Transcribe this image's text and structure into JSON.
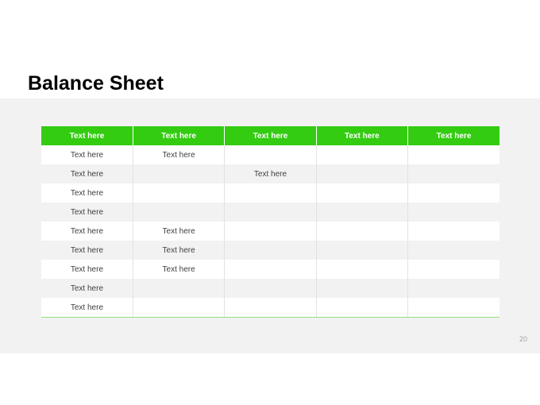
{
  "slide": {
    "title": "Balance Sheet",
    "page_number": "20"
  },
  "colors": {
    "header_bg": "#33cc11",
    "band_bg": "#f2f2f2"
  },
  "table": {
    "headers": [
      "Text here",
      "Text here",
      "Text here",
      "Text here",
      "Text here"
    ],
    "rows": [
      [
        "Text here",
        "Text here",
        "",
        "",
        ""
      ],
      [
        "Text here",
        "",
        "Text here",
        "",
        ""
      ],
      [
        "Text here",
        "",
        "",
        "",
        ""
      ],
      [
        "Text here",
        "",
        "",
        "",
        ""
      ],
      [
        "Text here",
        "Text here",
        "",
        "",
        ""
      ],
      [
        "Text here",
        "Text here",
        "",
        "",
        ""
      ],
      [
        "Text here",
        "Text here",
        "",
        "",
        ""
      ],
      [
        "Text here",
        "",
        "",
        "",
        ""
      ],
      [
        "Text here",
        "",
        "",
        "",
        ""
      ]
    ]
  }
}
